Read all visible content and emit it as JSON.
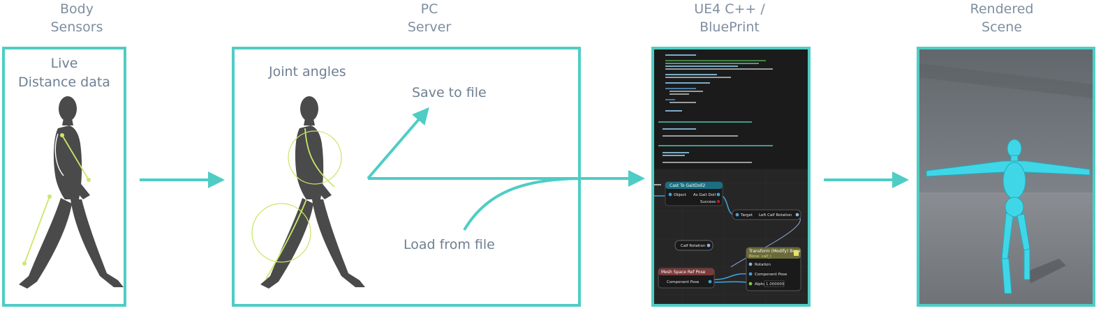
{
  "columns": [
    {
      "heading": "Body\nSensors"
    },
    {
      "heading": "PC\nServer"
    },
    {
      "heading": "UE4 C++ /\nBluePrint"
    },
    {
      "heading": "Rendered\nScene"
    }
  ],
  "sensors_panel": {
    "label": "Live\nDistance data"
  },
  "server_panel": {
    "joint_label": "Joint angles",
    "save_label": "Save to file",
    "load_label": "Load from file"
  },
  "blueprint": {
    "node_cast": {
      "title": "Cast To GaitDoll2",
      "pin_object": "Object",
      "pin_as": "As Gait Doll 2",
      "pin_success": "Success"
    },
    "node_target": {
      "pin_target": "Target",
      "pin_out": "Left Calf Rotation"
    },
    "node_calf": {
      "title": "Calf Rotation"
    },
    "node_transform": {
      "title": "Transform (Modify) Bone",
      "subtitle": "Bone: calf_l",
      "pin_rotation": "Rotation",
      "pin_pose": "Component Pose",
      "pin_alpha": "Alpha",
      "alpha_value": "1.000000"
    },
    "node_mesh": {
      "title": "Mesh Space Ref Pose",
      "pin_pose": "Component Pose"
    }
  },
  "colors": {
    "accent": "#4ecdc4",
    "figure": "#4a4a4a",
    "highlight": "#c9e86a",
    "mannequin": "#3fd7e8"
  }
}
